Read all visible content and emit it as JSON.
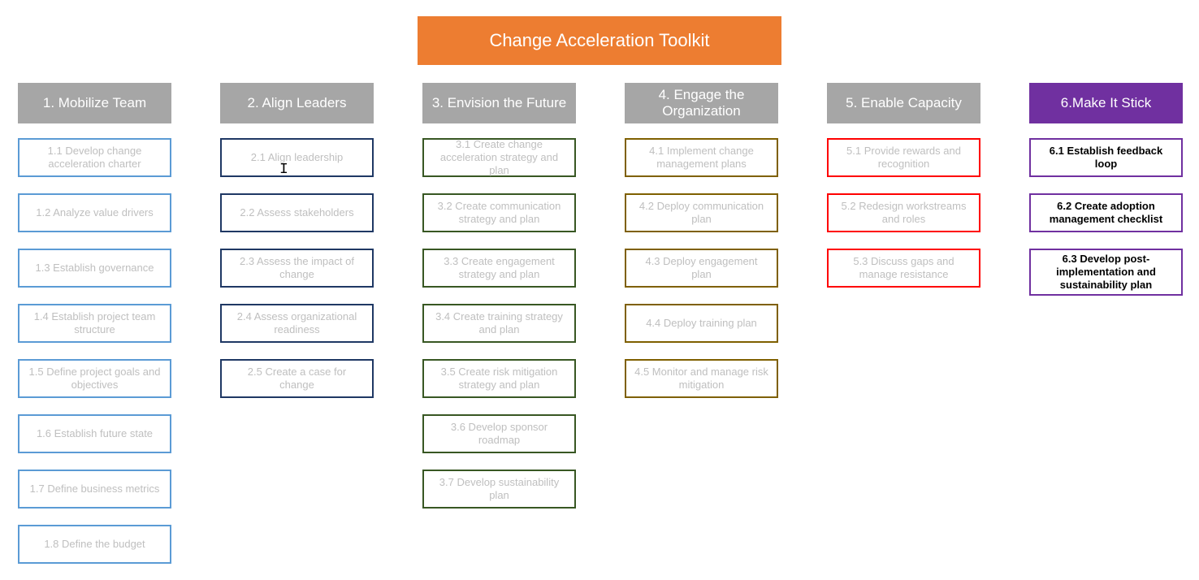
{
  "title": "Change Acceleration Toolkit",
  "columns": [
    {
      "header": "1. Mobilize Team",
      "headerStyle": "gray",
      "borderClass": "c-blue",
      "items": [
        {
          "label": "1.1 Develop change acceleration charter"
        },
        {
          "label": "1.2 Analyze value drivers"
        },
        {
          "label": "1.3 Establish governance"
        },
        {
          "label": "1.4 Establish project team structure"
        },
        {
          "label": "1.5 Define project goals and objectives"
        },
        {
          "label": "1.6 Establish future state"
        },
        {
          "label": "1.7 Define business metrics"
        },
        {
          "label": "1.8 Define the budget"
        }
      ]
    },
    {
      "header": "2. Align Leaders",
      "headerStyle": "gray",
      "borderClass": "c-navy",
      "items": [
        {
          "label": "2.1 Align leadership"
        },
        {
          "label": "2.2 Assess stakeholders"
        },
        {
          "label": "2.3 Assess the impact of change"
        },
        {
          "label": "2.4 Assess organizational readiness"
        },
        {
          "label": "2.5 Create a case for change"
        }
      ]
    },
    {
      "header": "3. Envision the Future",
      "headerStyle": "gray",
      "borderClass": "c-green",
      "items": [
        {
          "label": "3.1 Create change acceleration strategy and plan"
        },
        {
          "label": "3.2 Create communication strategy and plan"
        },
        {
          "label": "3.3 Create engagement strategy and plan"
        },
        {
          "label": "3.4 Create training strategy and plan"
        },
        {
          "label": "3.5 Create risk mitigation strategy and plan"
        },
        {
          "label": "3.6 Develop sponsor roadmap"
        },
        {
          "label": "3.7 Develop sustainability plan"
        }
      ]
    },
    {
      "header": "4. Engage the Organization",
      "headerStyle": "gray",
      "borderClass": "c-brown",
      "items": [
        {
          "label": "4.1 Implement change management plans"
        },
        {
          "label": "4.2 Deploy communication plan"
        },
        {
          "label": "4.3 Deploy engagement plan"
        },
        {
          "label": "4.4 Deploy training plan"
        },
        {
          "label": "4.5 Monitor and manage risk mitigation"
        }
      ]
    },
    {
      "header": "5. Enable Capacity",
      "headerStyle": "gray",
      "borderClass": "c-red",
      "items": [
        {
          "label": "5.1 Provide rewards and recognition"
        },
        {
          "label": "5.2 Redesign workstreams and roles"
        },
        {
          "label": "5.3 Discuss gaps and manage resistance"
        }
      ]
    },
    {
      "header": "6.Make It Stick",
      "headerStyle": "purple",
      "borderClass": "c-purple",
      "items": [
        {
          "label": "6.1 Establish feedback loop",
          "bold": true
        },
        {
          "label": "6.2 Create adoption management checklist",
          "bold": true
        },
        {
          "label": "6.3 Develop post-implementation and sustainability plan",
          "bold": true,
          "tall": true
        }
      ]
    }
  ]
}
